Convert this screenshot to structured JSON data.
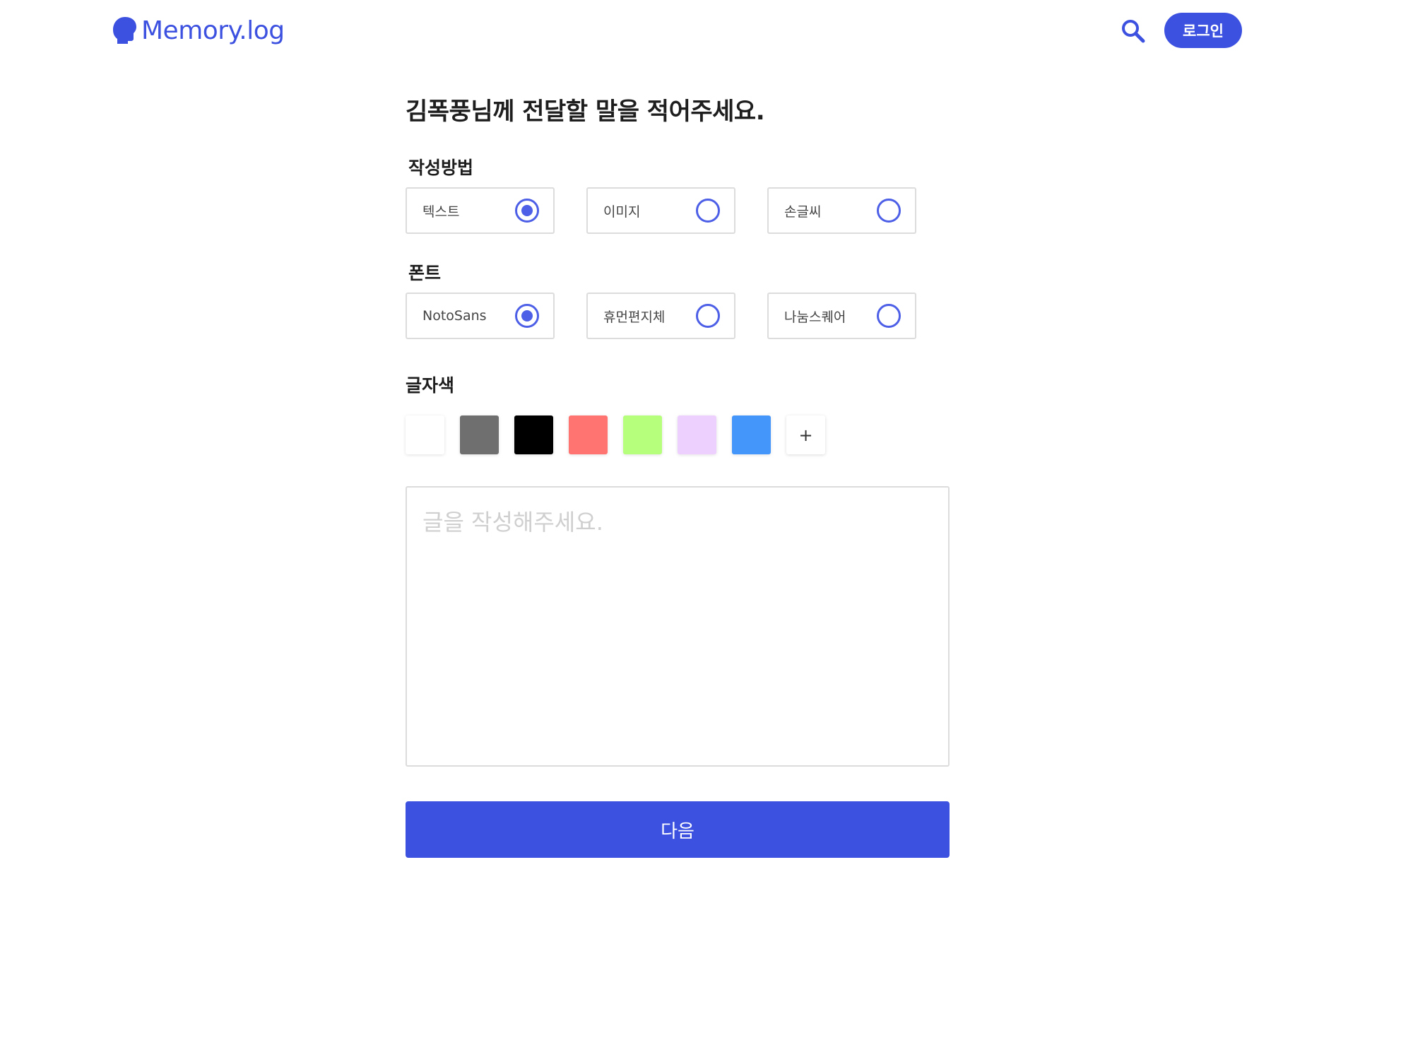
{
  "header": {
    "logo_text": "Memory.log",
    "logo_icon": "head-silhouette-icon",
    "search_icon": "search-icon",
    "login_label": "로그인",
    "brand_color": "#3d51e0"
  },
  "main": {
    "title": "김폭풍님께 전달할 말을 적어주세요.",
    "write_method": {
      "label": "작성방법",
      "options": [
        {
          "label": "텍스트",
          "selected": true
        },
        {
          "label": "이미지",
          "selected": false
        },
        {
          "label": "손글씨",
          "selected": false
        }
      ]
    },
    "font": {
      "label": "폰트",
      "options": [
        {
          "label": "NotoSans",
          "selected": true
        },
        {
          "label": "휴먼편지체",
          "selected": false
        },
        {
          "label": "나눔스퀘어",
          "selected": false
        }
      ]
    },
    "text_color": {
      "label": "글자색",
      "swatches": [
        "#ffffff",
        "#6f6f6f",
        "#000000",
        "#ff7470",
        "#b6ff7c",
        "#eed0ff",
        "#4596fa"
      ],
      "add_label": "+"
    },
    "editor": {
      "placeholder": "글을 작성해주세요.",
      "value": ""
    },
    "next_label": "다음"
  }
}
